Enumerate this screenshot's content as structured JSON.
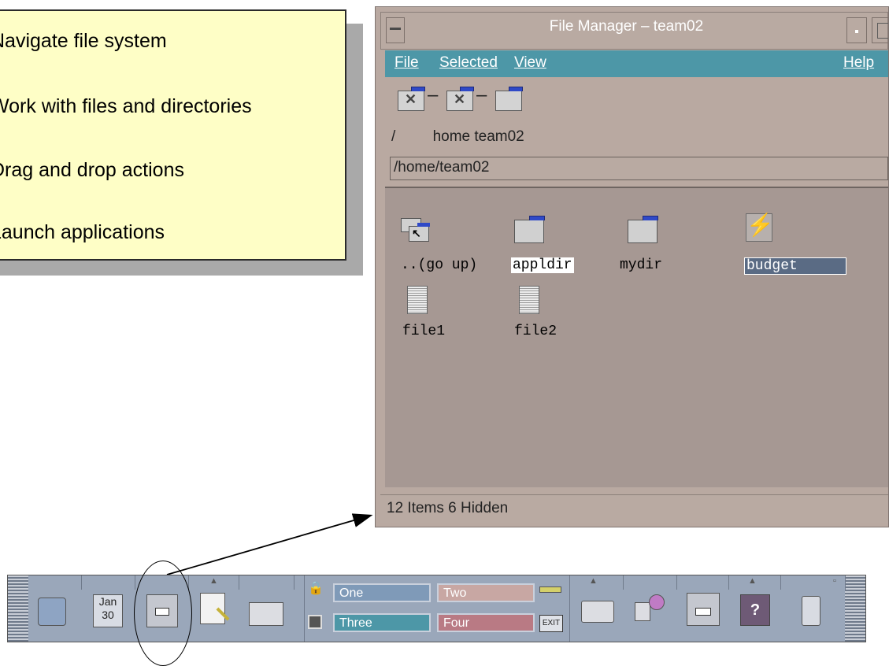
{
  "callout": {
    "items": [
      "Navigate file system",
      "Work with files and directories",
      "Drag and drop actions",
      "Launch applications"
    ]
  },
  "file_manager": {
    "title": "File Manager – team02",
    "menu": {
      "file": "File",
      "selected": "Selected",
      "view": "View",
      "help": "Help"
    },
    "path_labels": {
      "root": "/",
      "home": "home",
      "team": "team02"
    },
    "path_field": "/home/team02",
    "items": [
      {
        "label": "..(go up)",
        "type": "up"
      },
      {
        "label": "appldir",
        "type": "folder"
      },
      {
        "label": "mydir",
        "type": "folder"
      },
      {
        "label": "budget",
        "type": "app"
      },
      {
        "label": "file1",
        "type": "document"
      },
      {
        "label": "file2",
        "type": "document"
      }
    ],
    "status": "12 Items 6 Hidden"
  },
  "front_panel": {
    "calendar": {
      "month": "Jan",
      "day": "30"
    },
    "workspaces": [
      {
        "label": "One",
        "color": "#7f9ab8"
      },
      {
        "label": "Two",
        "color": "#c8a7a3"
      },
      {
        "label": "Three",
        "color": "#4d97a7"
      },
      {
        "label": "Four",
        "color": "#b97a84"
      }
    ],
    "exit_label": "EXIT"
  }
}
